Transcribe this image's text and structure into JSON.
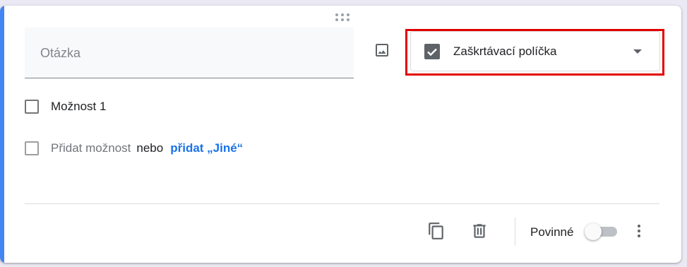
{
  "question": {
    "placeholder": "Otázka",
    "type_label": "Zaškrtávací políčka"
  },
  "options": {
    "items": [
      {
        "label": "Možnost 1"
      }
    ],
    "add_option_label": "Přidat možnost",
    "or_label": "nebo",
    "add_other_label": "přidat „Jiné“"
  },
  "footer": {
    "required_label": "Povinné",
    "required": false
  },
  "icons": {
    "drag": "drag-handle-icon",
    "image": "image-icon",
    "type": "checkbox-icon",
    "dropdown": "dropdown-arrow-icon",
    "duplicate": "duplicate-icon",
    "delete": "delete-icon",
    "more": "more-vert-icon"
  },
  "colors": {
    "accent": "#4285f4",
    "highlight": "#e30000",
    "link": "#1a73e8"
  }
}
